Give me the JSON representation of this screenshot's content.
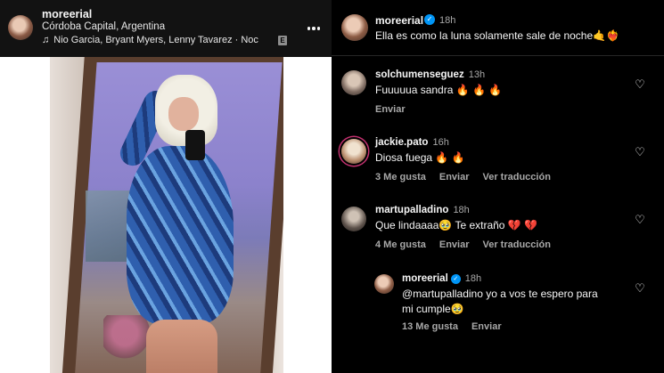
{
  "post": {
    "username": "moreerial",
    "location": "Córdoba Capital, Argentina",
    "music_icon": "music-note-icon",
    "music": "Nio Garcia, Bryant Myers, Lenny Tavarez · Noc",
    "explicit": "E",
    "more_icon": "more-options-icon"
  },
  "caption": {
    "username": "moreerial",
    "verified_mark": "✓",
    "time": "18h",
    "text": "Ella es como la luna solamente sale de noche🤙❤️‍🔥"
  },
  "comments": [
    {
      "username": "solchumenseguez",
      "time": "13h",
      "text": "Fuuuuua sandra 🔥 🔥 🔥",
      "actions": [
        "Enviar"
      ]
    },
    {
      "username": "jackie.pato",
      "time": "16h",
      "text": "Diosa fuega 🔥 🔥",
      "actions": [
        "3 Me gusta",
        "Enviar",
        "Ver traducción"
      ]
    },
    {
      "username": "martupalladino",
      "time": "18h",
      "text": "Que lindaaaa🥹 Te extraño 💔 💔",
      "actions": [
        "4 Me gusta",
        "Enviar",
        "Ver traducción"
      ]
    },
    {
      "username": "moreerial",
      "verified_mark": "✓",
      "time": "18h",
      "text_line1": "@martupalladino yo a vos te espero para",
      "text_line2": "mi cumple🥹",
      "actions": [
        "13 Me gusta",
        "Enviar"
      ]
    }
  ],
  "like_icon": "♡",
  "colors": {
    "background": "#000000",
    "header": "#121212",
    "secondary_text": "#a8a8a8",
    "verified": "#0095f6"
  }
}
